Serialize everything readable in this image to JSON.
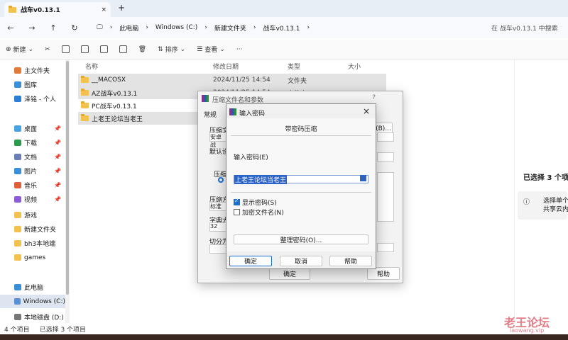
{
  "window": {
    "tab_title": "战车v0.13.1",
    "new_tab": "+",
    "close": "×"
  },
  "nav": {
    "breadcrumb": [
      "此电脑",
      "Windows (C:)",
      "新建文件夹",
      "战车v0.13.1"
    ],
    "search_placeholder": "在 战车v0.13.1 中搜索"
  },
  "toolbar": {
    "new": "新建",
    "sort": "排序",
    "view": "查看",
    "more": "···"
  },
  "sidebar": [
    {
      "label": "主文件夹",
      "icon": "home-icon",
      "color": "#e07b39",
      "sel": false
    },
    {
      "label": "图库",
      "icon": "gallery-icon",
      "color": "#3a8fd9",
      "sel": false
    },
    {
      "label": "泽铭 - 个人",
      "icon": "cloud-icon",
      "color": "#2b7fd6",
      "sel": false
    },
    {
      "label": "桌面",
      "icon": "desktop-icon",
      "color": "#4aa3e0",
      "sel": false,
      "pin": "📌"
    },
    {
      "label": "下载",
      "icon": "download-icon",
      "color": "#2b9a4a",
      "sel": false,
      "pin": "📌"
    },
    {
      "label": "文档",
      "icon": "documents-icon",
      "color": "#6a7fb5",
      "sel": false,
      "pin": "📌"
    },
    {
      "label": "图片",
      "icon": "pictures-icon",
      "color": "#3a8fd9",
      "sel": false,
      "pin": "📌"
    },
    {
      "label": "音乐",
      "icon": "music-icon",
      "color": "#e0603a",
      "sel": false,
      "pin": "📌"
    },
    {
      "label": "视频",
      "icon": "videos-icon",
      "color": "#8b5cd6",
      "sel": false,
      "pin": "📌"
    },
    {
      "label": "游戏",
      "icon": "folder-icon",
      "color": "#f2c14e",
      "sel": false
    },
    {
      "label": "新建文件夹",
      "icon": "folder-icon",
      "color": "#f2c14e",
      "sel": false
    },
    {
      "label": "bh3本地端",
      "icon": "folder-icon",
      "color": "#f2c14e",
      "sel": false
    },
    {
      "label": "games",
      "icon": "folder-icon",
      "color": "#f2c14e",
      "sel": false
    },
    {
      "label": "此电脑",
      "icon": "computer-icon",
      "color": "#3a8fd9",
      "sel": false
    },
    {
      "label": "Windows (C:)",
      "icon": "drive-icon",
      "color": "#5b8fd1",
      "sel": true
    },
    {
      "label": "本地磁盘 (D:)",
      "icon": "drive-icon",
      "color": "#777777",
      "sel": false
    }
  ],
  "list": {
    "headers": [
      "名称",
      "修改日期",
      "类型",
      "大小"
    ],
    "rows": [
      {
        "name": "__MACOSX",
        "date": "2024/11/25 14:54",
        "type": "文件夹",
        "sel": true
      },
      {
        "name": "AZ战车v0.13.1",
        "date": "2024/11/25 14:54",
        "type": "文件夹",
        "sel": true
      },
      {
        "name": "PC战车v0.13.1",
        "date": "",
        "type": "",
        "sel": false
      },
      {
        "name": "上老王论坛当老王",
        "date": "",
        "type": "",
        "sel": true
      }
    ]
  },
  "detail": {
    "title": "已选择 3 个项",
    "line1": "选择单个",
    "line2": "共享云内"
  },
  "status": {
    "items": "4 个项目",
    "selected": "已选择 3 个项目"
  },
  "archive_dialog": {
    "title": "压缩文件名和参数",
    "help": "?",
    "tab": "常规",
    "labels": [
      "压缩文",
      "安卓 战",
      "默认设",
      "压缩文",
      "压缩方",
      "标准",
      "字典大",
      "32",
      "切分为"
    ],
    "browse": "(B)...",
    "ok": "确定",
    "help_btn": "帮助"
  },
  "password_dialog": {
    "title": "输入密码",
    "subtitle": "带密码压缩",
    "prompt": "输入密码(E)",
    "password": "上老王论坛当老王",
    "show_password": "显示密码(S)",
    "encrypt_names": "加密文件名(N)",
    "organize": "整理密码(O)...",
    "ok": "确定",
    "cancel": "取消",
    "help": "帮助",
    "close": "×"
  },
  "watermark": {
    "text": "老王论坛",
    "url": "laowang.vip"
  }
}
